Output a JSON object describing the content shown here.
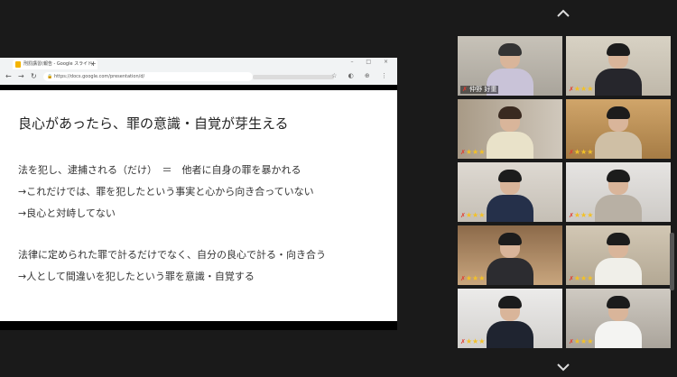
{
  "browser": {
    "tab_title": "刑罰講習(報告 - Google スライド",
    "tab_close": "×",
    "new_tab": "+",
    "window_controls": "– □ ×",
    "url": "https://docs.google.com/presentation/d/",
    "toolbar_icons": "☆ ◐ ⊕ ⋮"
  },
  "slide": {
    "title": "良心があったら、罪の意識・自覚が芽生える",
    "lines": [
      "法を犯し、逮捕される（だけ）　＝　他者に自身の罪を暴かれる",
      "→これだけでは、罪を犯したという事実と心から向き合っていない",
      "→良心と対峙してない",
      "法律に定められた罪で計るだけでなく、自分の良心で計る・向き合う",
      "→人として間違いを犯したという罪を意識・自覚する"
    ]
  },
  "gallery": {
    "participants": [
      {
        "name": "仲野 好重",
        "stars": ""
      },
      {
        "name": "",
        "stars": "★★★"
      },
      {
        "name": "",
        "stars": "★★★"
      },
      {
        "name": "",
        "stars": "★★★"
      },
      {
        "name": "",
        "stars": "★★★"
      },
      {
        "name": "",
        "stars": "★★★"
      },
      {
        "name": "",
        "stars": "★★★"
      },
      {
        "name": "",
        "stars": "★★★"
      },
      {
        "name": "",
        "stars": "★★★"
      },
      {
        "name": "",
        "stars": "★★★"
      }
    ]
  }
}
